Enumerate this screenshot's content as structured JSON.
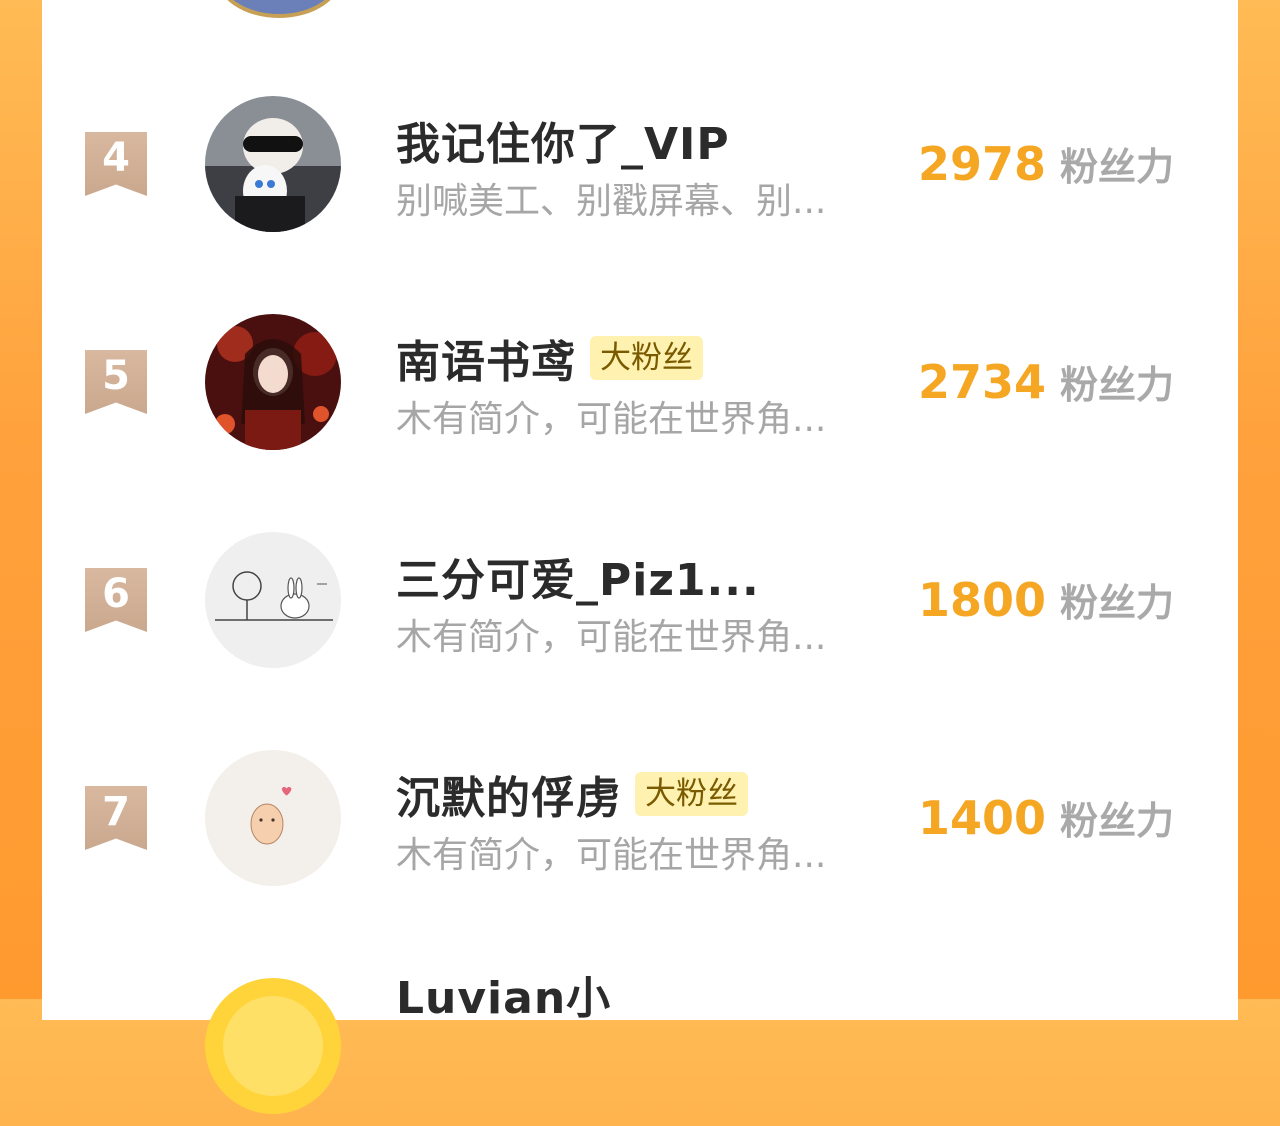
{
  "fans": [
    {
      "rank": "4",
      "name": "我记住你了_VIP",
      "badge": "",
      "intro": "别喊美工、别戳屏幕、别...",
      "score": "2978",
      "unit": "粉丝力"
    },
    {
      "rank": "5",
      "name": "南语书鸢",
      "badge": "大粉丝",
      "intro": "木有简介，可能在世界角...",
      "score": "2734",
      "unit": "粉丝力"
    },
    {
      "rank": "6",
      "name": "三分可爱_Piz1...",
      "badge": "",
      "intro": "木有简介，可能在世界角...",
      "score": "1800",
      "unit": "粉丝力"
    },
    {
      "rank": "7",
      "name": "沉默的俘虏",
      "badge": "大粉丝",
      "intro": "木有简介，可能在世界角...",
      "score": "1400",
      "unit": "粉丝力"
    },
    {
      "name": "Luvian小"
    }
  ],
  "colors": {
    "score": "#f5a623",
    "badge_bg": "#fff2b0",
    "rank_ribbon": "#c9a88e",
    "background": "#ffa13c"
  }
}
